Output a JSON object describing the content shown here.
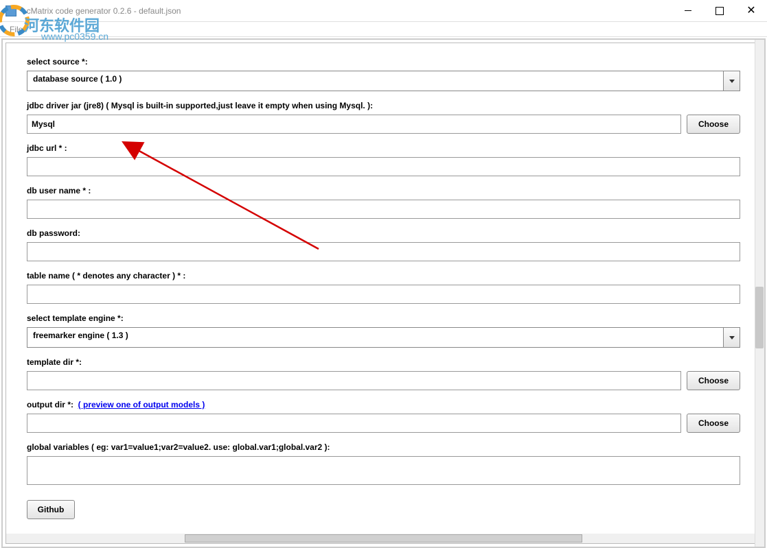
{
  "window": {
    "title": "LcMatrix code generator 0.2.6 - default.json"
  },
  "menu": {
    "file": "File"
  },
  "watermark": {
    "text1": "河东软件园",
    "text2": "www.pc0359.cn"
  },
  "form": {
    "selectSource": {
      "label": "select source *:",
      "value": "database source ( 1.0 )"
    },
    "jdbcDriver": {
      "label": "jdbc driver jar (jre8) ( Mysql is built-in supported,just leave it empty when using Mysql. ):",
      "value": "Mysql",
      "chooseBtn": "Choose"
    },
    "jdbcUrl": {
      "label": "jdbc url * :",
      "value": ""
    },
    "dbUser": {
      "label": "db user name * :",
      "value": ""
    },
    "dbPassword": {
      "label": "db password:",
      "value": ""
    },
    "tableName": {
      "label": "table name ( * denotes any character ) * :",
      "value": ""
    },
    "templateEngine": {
      "label": "select template engine *:",
      "value": "freemarker engine ( 1.3 )"
    },
    "templateDir": {
      "label": "template dir *:",
      "value": "",
      "chooseBtn": "Choose"
    },
    "outputDir": {
      "label": "output dir *:",
      "linkText": "( preview one of output models )",
      "value": "",
      "chooseBtn": "Choose"
    },
    "globalVars": {
      "label": "global variables ( eg: var1=value1;var2=value2. use: global.var1;global.var2 ):",
      "value": ""
    },
    "githubBtn": "Github"
  }
}
